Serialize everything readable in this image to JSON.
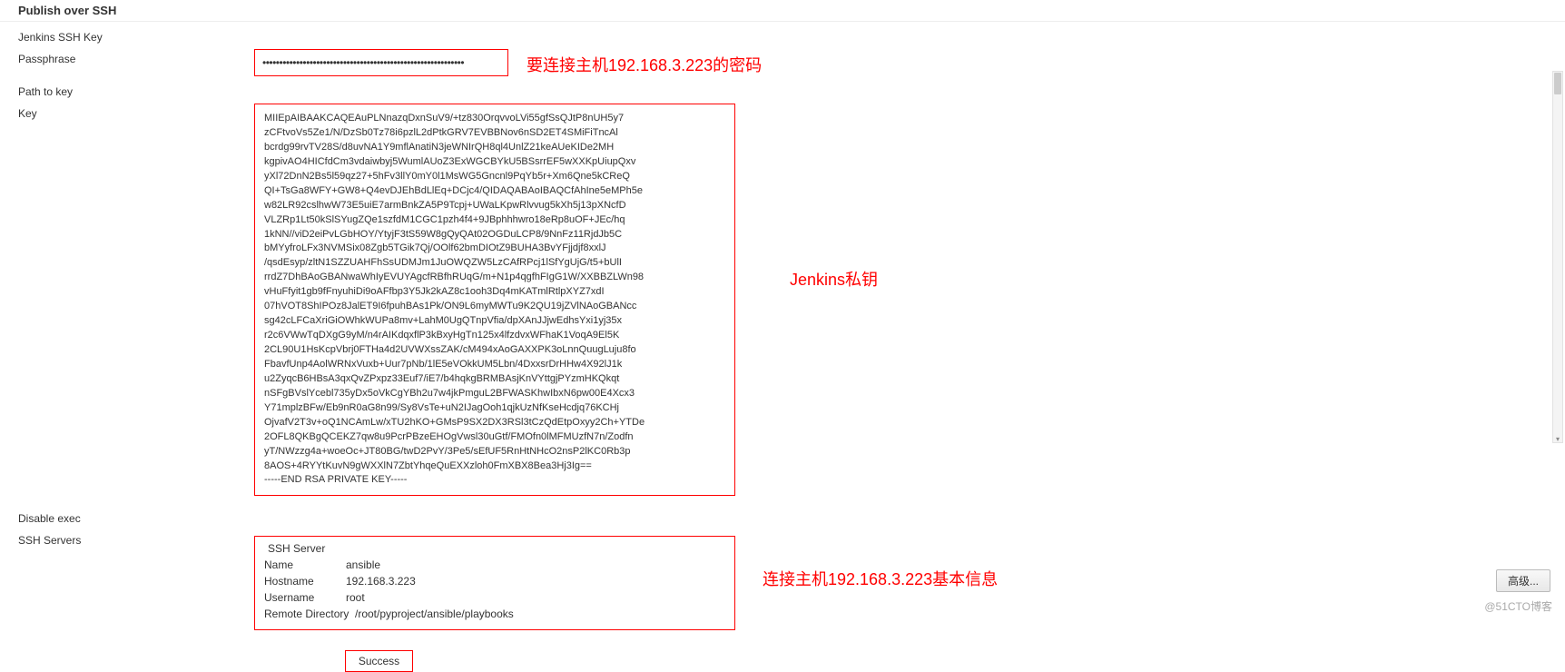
{
  "section": {
    "title": "Publish over SSH"
  },
  "labels": {
    "jenkins_ssh_key": "Jenkins SSH Key",
    "passphrase": "Passphrase",
    "path_to_key": "Path to key",
    "key": "Key",
    "disable_exec": "Disable exec",
    "ssh_servers": "SSH Servers"
  },
  "passphrase": {
    "masked": "••••••••••••••••••••••••••••••••••••••••••••••••••••••••••••"
  },
  "key": {
    "content": "MIIEpAIBAAKCAQEAuPLNnazqDxnSuV9/+tz830OrqvvoLVi55gfSsQJtP8nUH5y7\nzCFtvoVs5Ze1/N/DzSb0Tz78i6pzlL2dPtkGRV7EVBBNov6nSD2ET4SMiFiTncAl\nbcrdg99rvTV28S/d8uvNA1Y9mflAnatiN3jeWNIrQH8ql4UnlZ21keAUeKIDe2MH\nkgpivAO4HICfdCm3vdaiwbyj5WumlAUoZ3ExWGCBYkU5BSsrrEF5wXXKpUiupQxv\nyXl72DnN2Bs5l59qz27+5hFv3llY0mY0l1MsWG5Gncnl9PqYb5r+Xm6Qne5kCReQ\nQI+TsGa8WFY+GW8+Q4evDJEhBdLlEq+DCjc4/QIDAQABAoIBAQCfAhIne5eMPh5e\nw82LR92cslhwW73E5uiE7armBnkZA5P9Tcpj+UWaLKpwRlvvug5kXh5j13pXNcfD\nVLZRp1Lt50kSlSYugZQe1szfdM1CGC1pzh4f4+9JBphhhwro18eRp8uOF+JEc/hq\n1kNN//viD2eiPvLGbHOY/YtyjF3tS59W8gQyQAt02OGDuLCP8/9NnFz11RjdJb5C\nbMYyfroLFx3NVMSix08Zgb5TGik7Qj/OOlf62bmDIOtZ9BUHA3BvYFjjdjf8xxlJ\n/qsdEsyp/zltN1SZZUAHFhSsUDMJm1JuOWQZW5LzCAfRPcj1lSfYgUjG/t5+bUlI\nrrdZ7DhBAoGBANwaWhIyEVUYAgcfRBfhRUqG/m+N1p4qgfhFIgG1W/XXBBZLWn98\nvHuFfyit1gb9fFnyuhiDi9oAFfbp3Y5Jk2kAZ8c1ooh3Dq4mKATmlRtlpXYZ7xdI\n07hVOT8ShIPOz8JalET9I6fpuhBAs1Pk/ON9L6myMWTu9K2QU19jZVlNAoGBANcc\nsg42cLFCaXriGiOWhkWUPa8mv+LahM0UgQTnpVfia/dpXAnJJjwEdhsYxi1yj35x\nr2c6VWwTqDXgG9yM/n4rAIKdqxflP3kBxyHgTn125x4lfzdvxWFhaK1VoqA9El5K\n2CL90U1HsKcpVbrj0FTHa4d2UVWXssZAK/cM494xAoGAXXPK3oLnnQuugLuju8fo\nFbavfUnp4AolWRNxVuxb+Uur7pNb/1lE5eVOkkUM5Lbn/4DxxsrDrHHw4X92lJ1k\nu2ZyqcB6HBsA3qxQvZPxpz33Euf7/iE7/b4hqkgBRMBAsjKnVYttgjPYzmHKQkqt\nnSFgBVslYcebl735yDx5oVkCgYBh2u7w4jkPmguL2BFWASKhwIbxN6pw00E4Xcx3\nY71mplzBFw/Eb9nR0aG8n99/Sy8VsTe+uN2IJagOoh1qjkUzNfKseHcdjq76KCHj\nOjvafV2T3v+oQ1NCAmLw/xTU2hKO+GMsP9SX2DX3RSl3tCzQdEtpOxyy2Ch+YTDe\n2OFL8QKBgQCEKZ7qw8u9PcrPBzeEHOgVwsl30uGtf/FMOfn0lMFMUzfN7n/Zodfn\nyT/NWzzg4a+woeOc+JT80BG/twD2PvY/3Pe5/sEfUF5RnHtNHcO2nsP2lKC0Rb3p\n8AOS+4RYYtKuvN9gWXXlN7ZbtYhqeQuEXXzloh0FmXBX8Bea3Hj3Ig==\n-----END RSA PRIVATE KEY-----"
  },
  "ssh_server": {
    "heading": "SSH Server",
    "name_label": "Name",
    "name_value": "ansible",
    "hostname_label": "Hostname",
    "hostname_value": "192.168.3.223",
    "username_label": "Username",
    "username_value": "root",
    "remote_dir_label": "Remote Directory",
    "remote_dir_value": "/root/pyproject/ansible/playbooks"
  },
  "annotations": {
    "passphrase_note": "要连接主机192.168.3.223的密码",
    "key_note": "Jenkins私钥",
    "server_note": "连接主机192.168.3.223基本信息"
  },
  "status": {
    "success": "Success"
  },
  "buttons": {
    "advanced": "高级..."
  },
  "watermark": "@51CTO博客"
}
